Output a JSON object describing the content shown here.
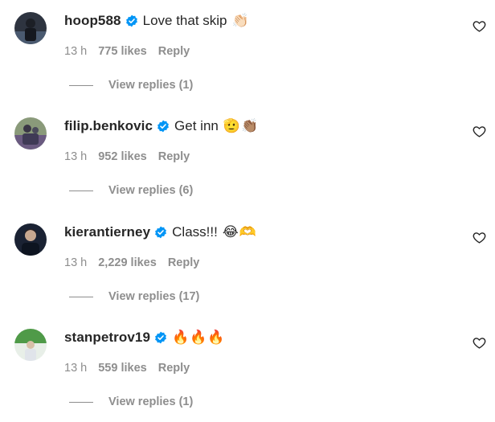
{
  "comments": [
    {
      "username": "hoop588",
      "text": "Love that skip",
      "emojis": "👏🏻",
      "time": "13 h",
      "likes": "775 likes",
      "reply_label": "Reply",
      "view_replies": "View replies (1)",
      "avatar_colors": [
        "#3a4250",
        "#1c1f26"
      ]
    },
    {
      "username": "filip.benkovic",
      "text": "Get inn",
      "emojis": "🫡👏🏽",
      "time": "13 h",
      "likes": "952 likes",
      "reply_label": "Reply",
      "view_replies": "View replies (6)",
      "avatar_colors": [
        "#7a8a6a",
        "#4a3f55"
      ]
    },
    {
      "username": "kierantierney",
      "text": "Class!!!",
      "emojis": "😂🫶",
      "time": "13 h",
      "likes": "2,229 likes",
      "reply_label": "Reply",
      "view_replies": "View replies (17)",
      "avatar_colors": [
        "#202a3a",
        "#0e1320"
      ]
    },
    {
      "username": "stanpetrov19",
      "text": "",
      "emojis": "🔥🔥🔥",
      "time": "13 h",
      "likes": "559 likes",
      "reply_label": "Reply",
      "view_replies": "View replies (1)",
      "avatar_colors": [
        "#5aa04a",
        "#d8e8d8"
      ]
    }
  ],
  "icons": {
    "verified": "verified-badge-icon",
    "like": "heart-outline-icon"
  },
  "colors": {
    "primary_text": "#262626",
    "secondary_text": "#8e8e8e",
    "verified_blue": "#0095f6"
  }
}
